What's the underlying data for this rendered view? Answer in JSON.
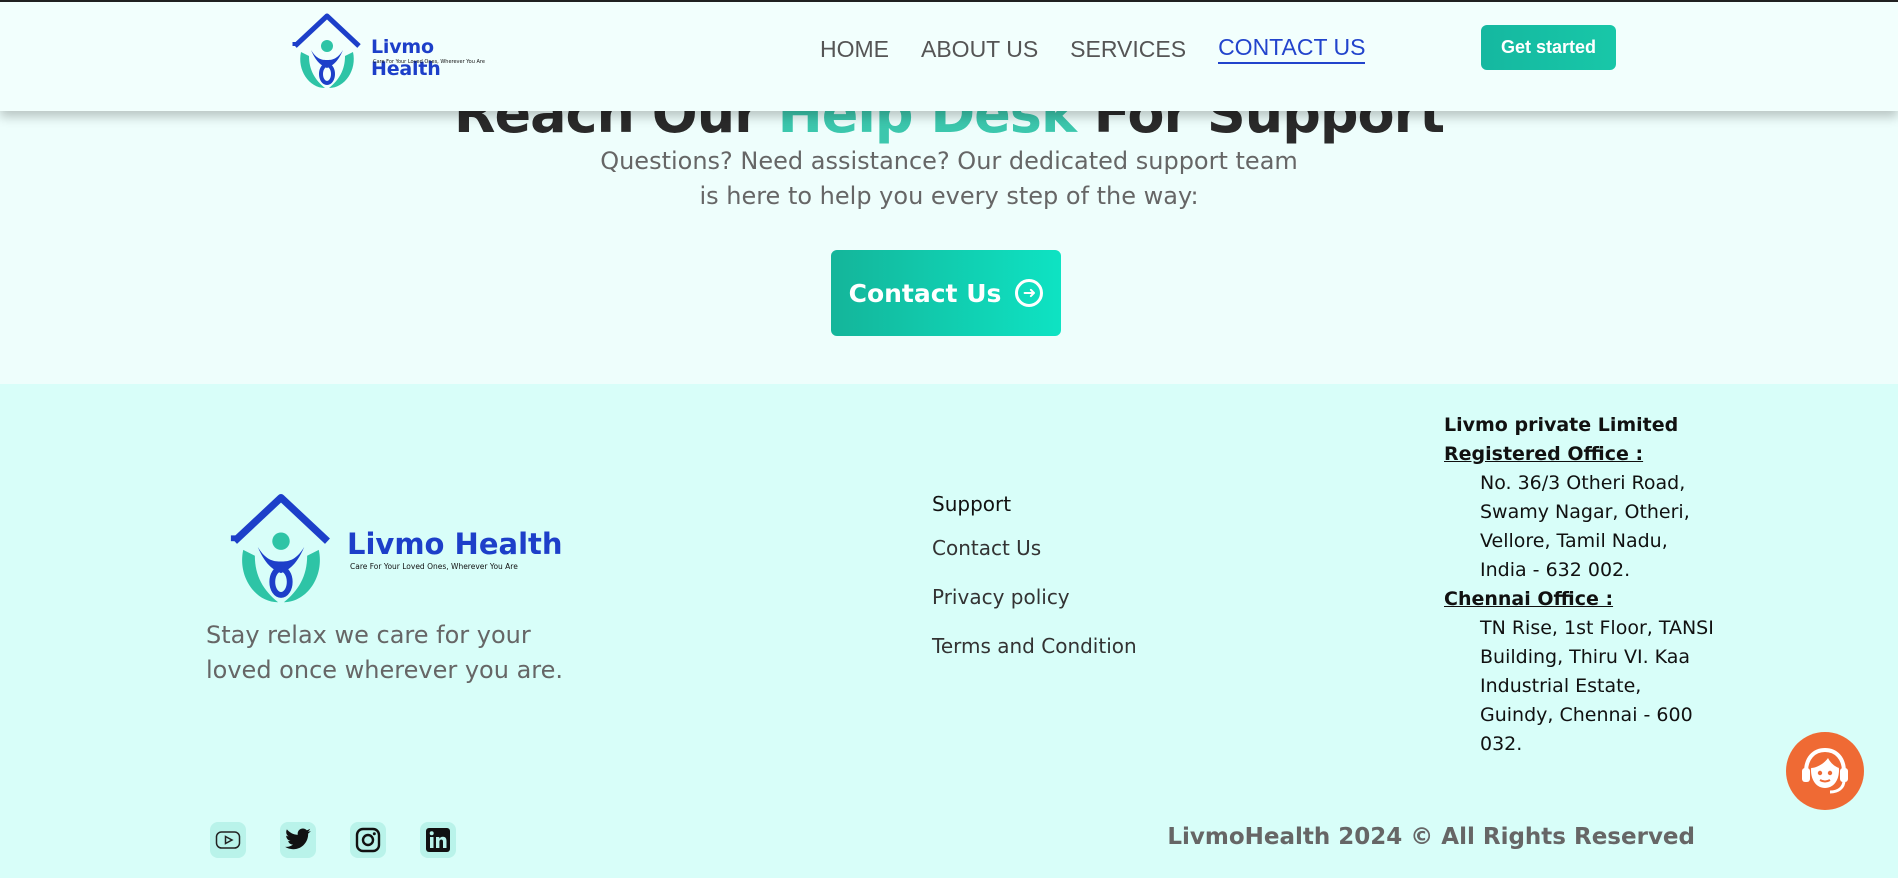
{
  "header": {
    "brand_name": "Livmo Health",
    "brand_tagline": "Care For Your Loved Ones, Wherever You Are",
    "nav": [
      {
        "label": "HOME"
      },
      {
        "label": "ABOUT US"
      },
      {
        "label": "SERVICES"
      },
      {
        "label": "CONTACT US",
        "active": true
      }
    ],
    "cta_label": "Get started"
  },
  "hero": {
    "heading_part1": "Reach Our ",
    "heading_highlight": "Help Desk",
    "heading_part2": " For Support",
    "subtitle_line1": "Questions? Need assistance? Our dedicated support team",
    "subtitle_line2": "is here to help you every step of the way:",
    "button_label": "Contact Us"
  },
  "footer": {
    "brand_name": "Livmo Health",
    "brand_tagline": "Care For Your Loved Ones, Wherever You Are",
    "tagline_line1": "Stay relax we care for your",
    "tagline_line2": "loved once wherever you are.",
    "support": {
      "title": "Support",
      "links": [
        "Contact Us",
        "Privacy policy",
        "Terms and Condition"
      ]
    },
    "company": {
      "name": "Livmo private Limited",
      "registered_title": "Registered Office :",
      "registered_address": [
        "No. 36/3 Otheri Road,",
        "Swamy Nagar, Otheri,",
        "Vellore, Tamil Nadu,",
        "India - 632 002."
      ],
      "chennai_title": "Chennai Office :",
      "chennai_address": [
        "TN Rise, 1st Floor, TANSI",
        "Building, Thiru VI. Kaa",
        "Industrial Estate,",
        "Guindy, Chennai - 600",
        "032."
      ]
    },
    "social": [
      "youtube-icon",
      "twitter-icon",
      "instagram-icon",
      "linkedin-icon"
    ],
    "copyright": "LivmoHealth 2024 © All Rights Reserved"
  },
  "colors": {
    "brand_blue": "#1d3fc9",
    "brand_teal": "#2ec4a6",
    "chat_orange": "#ef6a34",
    "footer_bg": "#d8fef9"
  }
}
